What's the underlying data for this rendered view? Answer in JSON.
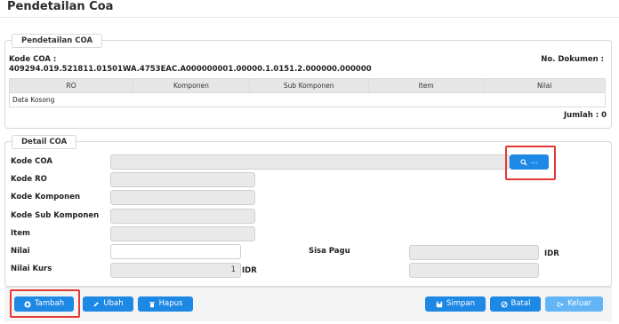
{
  "page": {
    "title": "Pendetailan Coa"
  },
  "pendetailan": {
    "legend": "Pendetailan COA",
    "kode_coa_label": "Kode COA :",
    "kode_coa_value": "409294.019.521811.01501WA.4753EAC.A000000001.00000.1.0151.2.000000.000000",
    "no_dokumen_label": "No. Dokumen :",
    "table": {
      "columns": [
        "RO",
        "Komponen",
        "Sub Komponen",
        "Item",
        "Nilai"
      ],
      "empty_text": "Data Kosong"
    },
    "jumlah_label": "Jumlah : 0"
  },
  "detail": {
    "legend": "Detail COA",
    "kode_coa_label": "Kode COA",
    "kode_ro_label": "Kode RO",
    "kode_komponen_label": "Kode Komponen",
    "kode_sub_komponen_label": "Kode Sub Komponen",
    "item_label": "Item",
    "nilai_label": "Nilai",
    "nilai_kurs_label": "Nilai Kurs",
    "nilai_kurs_value": "1",
    "idr_label": "IDR",
    "sisa_pagu_label": "Sisa Pagu",
    "sisa_idr_label": "IDR",
    "search_button_label": "...",
    "nilai_value": "",
    "sisa_pagu_value": "",
    "bottom_right_value": ""
  },
  "actions": {
    "tambah": "Tambah",
    "ubah": "Ubah",
    "hapus": "Hapus",
    "simpan": "Simpan",
    "batal": "Batal",
    "keluar": "Keluar"
  },
  "colors": {
    "primary": "#1e88e5",
    "primary_light": "#64b5f6",
    "highlight": "#e53935"
  }
}
